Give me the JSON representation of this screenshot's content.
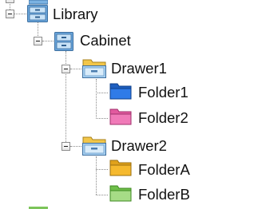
{
  "tree": {
    "root": {
      "label": "Library",
      "icon": "cabinet-icon",
      "expanded": true,
      "children": [
        {
          "label": "Cabinet",
          "icon": "cabinet-icon",
          "expanded": true,
          "children": [
            {
              "label": "Drawer1",
              "icon": "drawer-icon",
              "expanded": true,
              "children": [
                {
                  "label": "Folder1",
                  "icon": "folder-icon",
                  "color": "#2f7be8"
                },
                {
                  "label": "Folder2",
                  "icon": "folder-icon",
                  "color": "#f07ab8"
                }
              ]
            },
            {
              "label": "Drawer2",
              "icon": "drawer-icon",
              "expanded": true,
              "children": [
                {
                  "label": "FolderA",
                  "icon": "folder-icon",
                  "color": "#f5b92e"
                },
                {
                  "label": "FolderB",
                  "icon": "folder-icon",
                  "color": "#8fd16a"
                }
              ]
            }
          ]
        }
      ]
    }
  },
  "colors": {
    "cabinet": "#6aa6dc",
    "drawer_tab": "#f2c649",
    "drawer_front": "#a9d2f2",
    "guide": "#8a8a8a"
  }
}
